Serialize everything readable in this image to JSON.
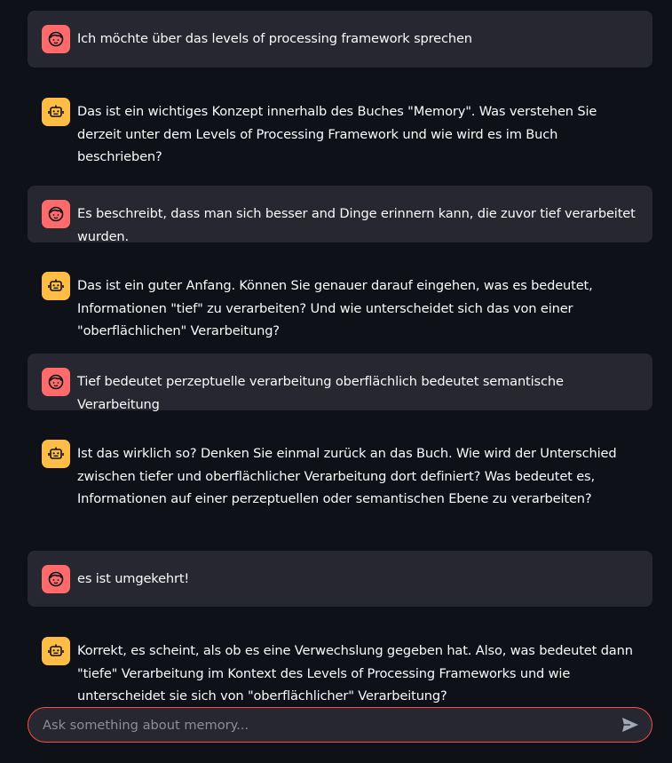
{
  "messages": [
    {
      "role": "user",
      "avatar_icon": "user-face-icon",
      "text": "Ich möchte über das levels of processing framework sprechen"
    },
    {
      "role": "assistant",
      "avatar_icon": "robot-icon",
      "text": "Das ist ein wichtiges Konzept innerhalb des Buches \"Memory\". Was verstehen Sie derzeit unter dem Levels of Processing Framework und wie wird es im Buch beschrieben?"
    },
    {
      "role": "user",
      "avatar_icon": "user-face-icon",
      "text": "Es beschreibt, dass man sich besser and Dinge erinnern kann, die zuvor tief verarbeitet wurden."
    },
    {
      "role": "assistant",
      "avatar_icon": "robot-icon",
      "text": "Das ist ein guter Anfang. Können Sie genauer darauf eingehen, was es bedeutet, Informationen \"tief\" zu verarbeiten? Und wie unterscheidet sich das von einer \"oberflächlichen\" Verarbeitung?"
    },
    {
      "role": "user",
      "avatar_icon": "user-face-icon",
      "text": "Tief bedeutet perzeptuelle verarbeitung oberflächlich bedeutet semantische Verarbeitung"
    },
    {
      "role": "assistant",
      "avatar_icon": "robot-icon",
      "text": "Ist das wirklich so? Denken Sie einmal zurück an das Buch. Wie wird der Unterschied zwischen tiefer und oberflächlicher Verarbeitung dort definiert? Was bedeutet es, Informationen auf einer perzeptuellen oder semantischen Ebene zu verarbeiten?"
    },
    {
      "role": "user",
      "avatar_icon": "user-face-icon",
      "text": "es ist umgekehrt!"
    },
    {
      "role": "assistant",
      "avatar_icon": "robot-icon",
      "text": "Korrekt, es scheint, als ob es eine Verwechslung gegeben hat. Also, was bedeutet dann \"tiefe\" Verarbeitung im Kontext des Levels of Processing Frameworks und wie unterscheidet sie sich von \"oberflächlicher\" Verarbeitung?"
    }
  ],
  "chat_input": {
    "placeholder": "Ask something about memory...",
    "value": "",
    "send_icon": "send-icon"
  },
  "colors": {
    "background": "#0e1117",
    "user_bubble": "#262730",
    "user_avatar": "#ff6b6b",
    "assistant_avatar": "#ffbd45",
    "input_border": "#ff4b4b"
  }
}
